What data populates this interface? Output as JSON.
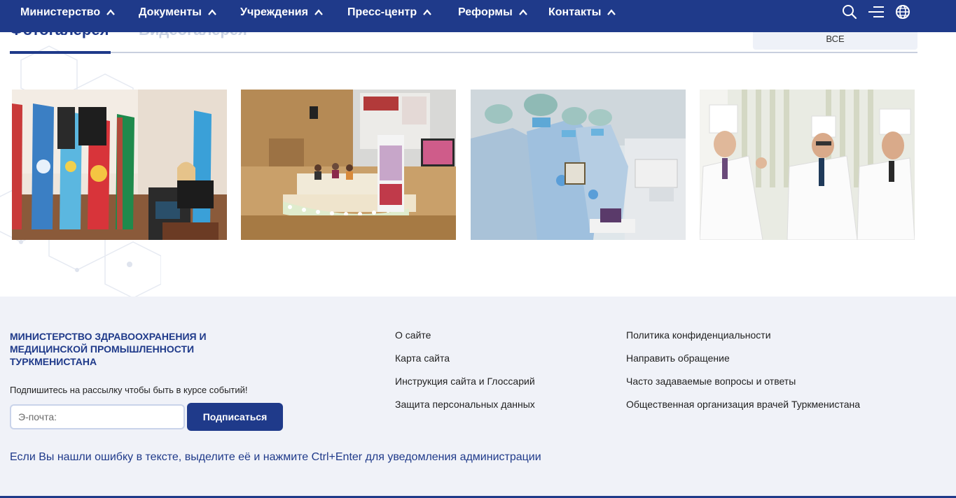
{
  "nav": {
    "items": [
      {
        "label": "Министерство"
      },
      {
        "label": "Документы"
      },
      {
        "label": "Учреждения"
      },
      {
        "label": "Пресс-центр"
      },
      {
        "label": "Реформы"
      },
      {
        "label": "Контакты"
      }
    ],
    "icons": [
      "search-icon",
      "menu-icon",
      "globe-icon"
    ]
  },
  "gallery": {
    "tabs": [
      {
        "label": "Фотогалерея",
        "active": true
      },
      {
        "label": "Видеогалерея",
        "active": false
      }
    ],
    "all_button": "ВСЕ",
    "photos": [
      {
        "name": "conference-speaker-flags"
      },
      {
        "name": "conference-hall-panel"
      },
      {
        "name": "lab-medical-training"
      },
      {
        "name": "doctors-in-white-coats"
      }
    ]
  },
  "footer": {
    "title": "МИНИСТЕРСТВО ЗДРАВООХРАНЕНИЯ И МЕДИЦИНСКОЙ ПРОМЫШЛЕННОСТИ ТУРКМЕНИСТАНА",
    "subscribe_text": "Подпишитесь на рассылку чтобы быть в курсе событий!",
    "email_placeholder": "Э-почта:",
    "subscribe_button": "Подписаться",
    "links_col1": [
      "О сайте",
      "Карта сайта",
      "Инструкция сайта и Глоссарий",
      "Защита персональных данных"
    ],
    "links_col2": [
      "Политика конфиденциальности",
      "Направить обращение",
      "Часто задаваемые вопросы и ответы",
      "Общественная организация врачей Туркменистана"
    ],
    "error_note": "Если Вы нашли ошибку в тексте, выделите её и нажмите Ctrl+Enter для уведомления администрации"
  },
  "colors": {
    "brand": "#1f3a8a",
    "footer_bg": "#f0f2f8",
    "tab_inactive": "#c9d2e3"
  }
}
